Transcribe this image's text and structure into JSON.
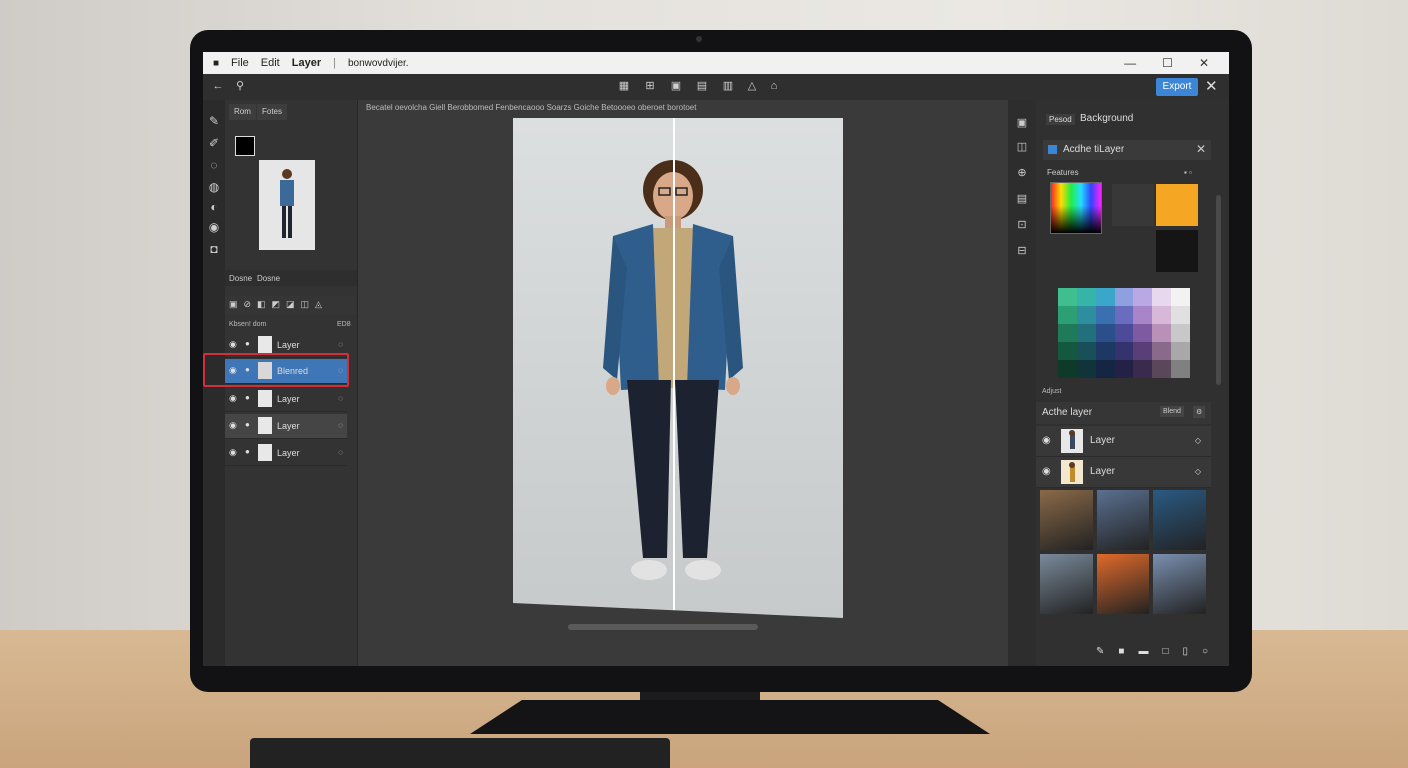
{
  "menubar": {
    "items": [
      "File",
      "Edit",
      "Layer"
    ],
    "doc_title": "bonwovdvijer."
  },
  "window_controls": [
    "—",
    "☐",
    "✕"
  ],
  "toolbar": {
    "export_label": "Export",
    "close_label": "✕"
  },
  "left_panel": {
    "tabs": [
      "Rom",
      "Fotes"
    ],
    "layers_tabs": [
      "Dosne",
      "Dosne"
    ],
    "layers_subheader": "Kbsen! dom",
    "layers_badge": "ED8"
  },
  "layers": [
    {
      "name": "Layer",
      "selected": false
    },
    {
      "name": "Blenred",
      "selected": true
    },
    {
      "name": "Layer",
      "selected": false
    },
    {
      "name": "Layer",
      "selected": false
    },
    {
      "name": "Layer",
      "selected": false
    }
  ],
  "canvas": {
    "breadcrumb": "Becatel oevolcha Giell Berobbomed Fenbencaooo Soarzs Goiche Betoooeo oberoet borotoet"
  },
  "right_panel": {
    "tab_small": "Pesod",
    "tab_title": "Background",
    "search_text": "Acdhe tiLayer",
    "features_label": "Features",
    "adjust_label": "Adjust",
    "active_layers_title": "Acthe layer",
    "blend_badge": "Blend",
    "swatch_colors": [
      "#383838",
      "#f5a623",
      "#151515"
    ],
    "active_layers": [
      {
        "name": "Layer"
      },
      {
        "name": "Layer"
      }
    ]
  },
  "palette_colors": [
    "#3fbf8f",
    "#35b5a8",
    "#3aa6c9",
    "#8fa0e0",
    "#b8a8e4",
    "#e8d8ee",
    "#f2f2f2",
    "#2c9f75",
    "#2d8f9e",
    "#3a6fb0",
    "#6a6cc0",
    "#a884c8",
    "#d8b8d8",
    "#e0e0e0",
    "#1f7a5a",
    "#21707b",
    "#2b4f8a",
    "#4d4a98",
    "#7e5aa2",
    "#b890b8",
    "#c8c8c8",
    "#155840",
    "#184f58",
    "#1e3866",
    "#35336e",
    "#5a3e78",
    "#8a6a8a",
    "#a8a8a8",
    "#0e3a2a",
    "#10343a",
    "#142644",
    "#232246",
    "#3a2a4e",
    "#5a485a",
    "#808080"
  ],
  "gallery_colors": [
    "#8a6a48",
    "#5a7090",
    "#2a5a84",
    "#7a8a9a",
    "#e06a2a",
    "#7a90b0"
  ]
}
